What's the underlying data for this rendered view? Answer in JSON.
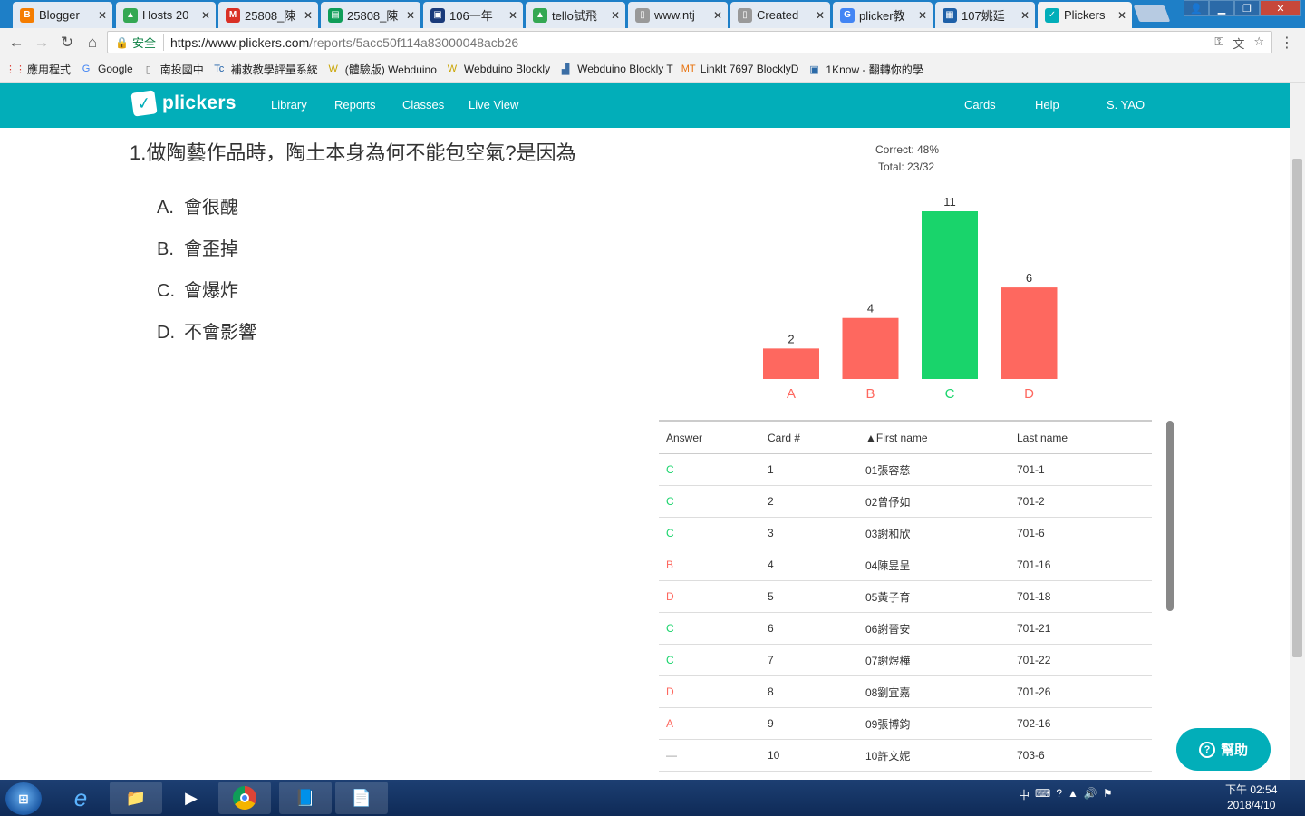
{
  "browser": {
    "tabs": [
      {
        "title": "Blogger",
        "color": "#f57d00",
        "glyph": "B"
      },
      {
        "title": "Hosts 20",
        "color": "#34a853",
        "glyph": "▲"
      },
      {
        "title": "25808_陳",
        "color": "#d93025",
        "glyph": "M"
      },
      {
        "title": "25808_陳",
        "color": "#0f9d58",
        "glyph": "▤"
      },
      {
        "title": "106一年",
        "color": "#1a3a7a",
        "glyph": "▣"
      },
      {
        "title": "tello試飛",
        "color": "#34a853",
        "glyph": "▲"
      },
      {
        "title": "www.ntj",
        "color": "#999999",
        "glyph": "▯"
      },
      {
        "title": "Created",
        "color": "#999999",
        "glyph": "▯"
      },
      {
        "title": "plicker教",
        "color": "#4285f4",
        "glyph": "G"
      },
      {
        "title": "107姚廷",
        "color": "#1e60a8",
        "glyph": "▦"
      },
      {
        "title": "Plickers",
        "color": "#02aeb9",
        "glyph": "✓"
      }
    ],
    "secure_label": "安全",
    "url_host": "https://www.plickers.com",
    "url_path": "/reports/5acc50f114a83000048acb26",
    "bookmarks": [
      {
        "label": "應用程式",
        "icon": "apps-icon"
      },
      {
        "label": "Google",
        "icon": "google-icon"
      },
      {
        "label": "南投國中",
        "icon": "page-icon"
      },
      {
        "label": "補救教學評量系統",
        "icon": "tc-icon"
      },
      {
        "label": "(體驗版) Webduino",
        "icon": "webduino-icon"
      },
      {
        "label": "Webduino Blockly",
        "icon": "webduino-icon"
      },
      {
        "label": "Webduino Blockly T",
        "icon": "blockly-icon"
      },
      {
        "label": "LinkIt 7697 BlocklyD",
        "icon": "mt-icon"
      },
      {
        "label": "1Know - 翻轉你的學",
        "icon": "1know-icon"
      }
    ]
  },
  "header": {
    "logo": "plickers",
    "nav_left": [
      "Library",
      "Reports",
      "Classes",
      "Live View"
    ],
    "nav_right": [
      "Cards",
      "Help",
      "S. YAO"
    ]
  },
  "question": {
    "text": "1.做陶藝作品時，陶土本身為何不能包空氣?是因為",
    "choices": [
      {
        "letter": "A.",
        "text": "會很醜"
      },
      {
        "letter": "B.",
        "text": "會歪掉"
      },
      {
        "letter": "C.",
        "text": "會爆炸"
      },
      {
        "letter": "D.",
        "text": "不會影響"
      }
    ]
  },
  "stats": {
    "correct": "Correct: 48%",
    "total": "Total: 23/32"
  },
  "chart_data": {
    "type": "bar",
    "categories": [
      "A",
      "B",
      "C",
      "D"
    ],
    "values": [
      2,
      4,
      11,
      6
    ],
    "correct": "C",
    "colors": {
      "correct": "#19d46b",
      "incorrect": "#fe685f"
    },
    "ylim": [
      0,
      11
    ]
  },
  "table": {
    "headers": [
      "Answer",
      "Card #",
      "▲First name",
      "Last name"
    ],
    "rows": [
      [
        "C",
        "1",
        "01張容慈",
        "701-1"
      ],
      [
        "C",
        "2",
        "02曾伃如",
        "701-2"
      ],
      [
        "C",
        "3",
        "03謝和欣",
        "701-6"
      ],
      [
        "B",
        "4",
        "04陳昱呈",
        "701-16"
      ],
      [
        "D",
        "5",
        "05黃子育",
        "701-18"
      ],
      [
        "C",
        "6",
        "06謝晉安",
        "701-21"
      ],
      [
        "C",
        "7",
        "07謝煜樺",
        "701-22"
      ],
      [
        "D",
        "8",
        "08劉宜嘉",
        "701-26"
      ],
      [
        "A",
        "9",
        "09張博鈞",
        "702-16"
      ],
      [
        "—",
        "10",
        "10許文妮",
        "703-6"
      ]
    ]
  },
  "help_button": "幫助",
  "taskbar": {
    "start": "start-icon",
    "apps": [
      "ie-icon",
      "explorer-icon",
      "media-icon",
      "chrome-icon",
      "writer-icon",
      "notepad-icon"
    ],
    "ime": "中",
    "time": "下午 02:54",
    "date": "2018/4/10"
  }
}
